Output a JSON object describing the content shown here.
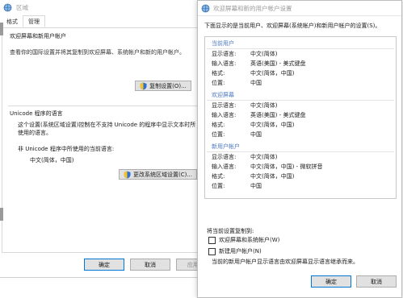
{
  "region_window": {
    "title": "区域",
    "tabs": [
      "格式",
      "管理"
    ],
    "group1": {
      "title": "欢迎屏幕和新用户帐户",
      "desc": "查看你的国际设置并将其复制到欢迎屏幕、系统帐户和新的用户帐户。",
      "copy_button": "复制设置(O)..."
    },
    "group2": {
      "title": "Unicode 程序的语言",
      "desc": "这个设置(系统区域设置)控制在不支持 Unicode 的程序中显示文本时所使用的语言。",
      "current_label": "非 Unicode 程序中所使用的当前语言:",
      "current_value": "中文(简体，中国)",
      "change_button": "更改系统区域设置(C)..."
    },
    "footer": {
      "ok": "确定",
      "cancel": "取消",
      "apply": "应用(A)"
    }
  },
  "welcome_window": {
    "title": "欢迎屏幕和新的用户帐户设置",
    "intro": "下面显示的是当前用户、欢迎屏幕(系统帐户)和新用户帐户的设置(S)。",
    "sections": [
      {
        "header": "当前用户",
        "rows": [
          {
            "k": "显示语言:",
            "v": "中文(简体)"
          },
          {
            "k": "输入语言:",
            "v": "英语(美国) - 美式键盘"
          },
          {
            "k": "格式:",
            "v": "中文(简体，中国)"
          },
          {
            "k": "位置:",
            "v": "中国"
          }
        ]
      },
      {
        "header": "欢迎屏幕",
        "rows": [
          {
            "k": "显示语言:",
            "v": "中文(简体)"
          },
          {
            "k": "输入语言:",
            "v": "英语(美国) - 美式键盘"
          },
          {
            "k": "格式:",
            "v": "中文(简体，中国)"
          },
          {
            "k": "位置:",
            "v": "中国"
          }
        ]
      },
      {
        "header": "新用户帐户",
        "rows": [
          {
            "k": "显示语言:",
            "v": "中文(简体)"
          },
          {
            "k": "输入语言:",
            "v": "中文(简体，中国) - 微软拼音"
          },
          {
            "k": "格式:",
            "v": "中文(简体，中国)"
          },
          {
            "k": "位置:",
            "v": "中国"
          }
        ]
      }
    ],
    "copy_label": "将当前设置复制到:",
    "checkboxes": [
      "欢迎屏幕和系统帐户(W)",
      "新建用户帐户(N)"
    ],
    "note": "当前的新用户帐户显示语言由欢迎屏幕显示语言继承而来。",
    "ok": "确定",
    "cancel": "取消"
  }
}
